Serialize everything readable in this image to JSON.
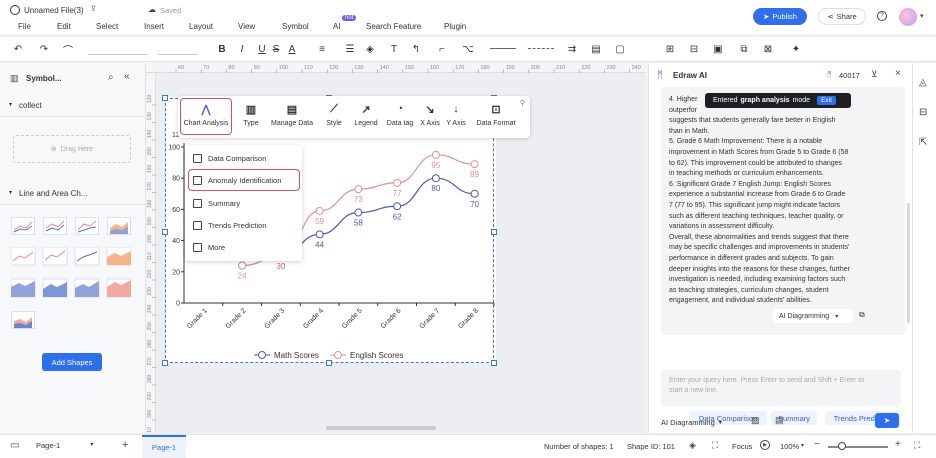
{
  "app": {
    "title": "Unnamed File(3)",
    "saved": "Saved",
    "publish": "Publish",
    "share": "Share"
  },
  "menu": [
    "File",
    "Edit",
    "Select",
    "Insert",
    "Layout",
    "View",
    "Symbol",
    "AI",
    "Search Feature",
    "Plugin"
  ],
  "ai_badge": "hot",
  "left_panel": {
    "title": "Symbol...",
    "collect": "collect",
    "drag_here": "Drag Here",
    "section": "Line and Area Ch...",
    "add_shapes": "Add Shapes"
  },
  "chart_toolbar": [
    "Chart Analysis",
    "Type",
    "Manage Data",
    "Style",
    "Legend",
    "Data tag",
    "X Axis",
    "Y Axis",
    "Data Format"
  ],
  "context_menu": [
    "Data Comparison",
    "Anomaly Identification",
    "Summary",
    "Trends Prediction",
    "More"
  ],
  "ruler_top": [
    "60",
    "70",
    "80",
    "90",
    "100",
    "110",
    "120",
    "130",
    "140",
    "150",
    "160",
    "170",
    "180",
    "190",
    "200",
    "210",
    "220",
    "230",
    "240",
    "250"
  ],
  "ruler_left": [
    "120",
    "130",
    "140",
    "150",
    "160",
    "170",
    "180",
    "190",
    "200",
    "210",
    "220",
    "230",
    "240",
    "250",
    "260",
    "270",
    "280",
    "290",
    "300",
    "310"
  ],
  "chart_data": {
    "type": "line",
    "categories": [
      "Grade 1",
      "Grade 2",
      "Grade 3",
      "Grade 4",
      "Grade 5",
      "Grade 6",
      "Grade 7",
      "Grade 8"
    ],
    "series": [
      {
        "name": "Math Scores",
        "color": "#4f5aa8",
        "values": [
          null,
          24,
          30,
          44,
          58,
          62,
          80,
          70
        ]
      },
      {
        "name": "English Scores",
        "color": "#e8918f",
        "values": [
          null,
          24,
          30,
          59,
          73,
          77,
          95,
          89
        ]
      }
    ],
    "data_labels": {
      "math": [
        "",
        "",
        "30",
        "44",
        "58",
        "62",
        "80",
        "70"
      ],
      "english": [
        "",
        "24",
        "30",
        "59",
        "73",
        "77",
        "95",
        "89"
      ]
    },
    "y_ticks": [
      "0",
      "20",
      "40",
      "60",
      "80",
      "100"
    ],
    "y_tick_top": "12",
    "ylim": [
      0,
      100
    ],
    "grid": false,
    "legend": "bottom"
  },
  "ai_panel": {
    "title": "Edraw AI",
    "credits": "40017",
    "toast_prefix": "Entered",
    "toast_bold": "graph analysis",
    "toast_suffix": "mode",
    "toast_exit": "Exit",
    "text_lines": [
      "4. Higher",
      "outperfor",
      "suggests that students generally fare better in English",
      "than in Math.",
      "5. Grade 6 Math Improvement: There is a notable",
      "improvement in Math Scores from Grade 5 to Grade 6 (58",
      "to 62). This improvement could be attributed to changes",
      "in teaching methods or curriculum enhancements.",
      "6. Significant Grade 7 English Jump: English Scores",
      "experience a substantial increase from Grade 6 to Grade",
      "7 (77 to 95). This significant jump might indicate factors",
      "such as different teaching techniques, teacher quality, or",
      "variations in assessment difficulty.",
      "Overall, these abnormalities and trends suggest that there",
      "may be specific challenges and improvements in students'",
      "performance in different grades and subjects. To gain",
      "deeper insights into the reasons for these changes, further",
      "investigation is needed, including examining factors such",
      "as teaching strategies, curriculum changes, student",
      "engagement, and individual students' abilities."
    ],
    "ai_diagramming": "AI Diagramming",
    "suggestions": [
      "Data Comparison",
      "Summary",
      "Trends Prediction"
    ],
    "input_placeholder_1": "Enter your query here. Press Enter to send and Shift + Enter to",
    "input_placeholder_2": "start a new line.",
    "mode": "AI Diagramming"
  },
  "status": {
    "page_select": "Page-1",
    "page_tab": "Page-1",
    "shapes": "Number of shapes: 1",
    "shape_id": "Shape ID: 101",
    "focus": "Focus",
    "zoom": "100%"
  }
}
